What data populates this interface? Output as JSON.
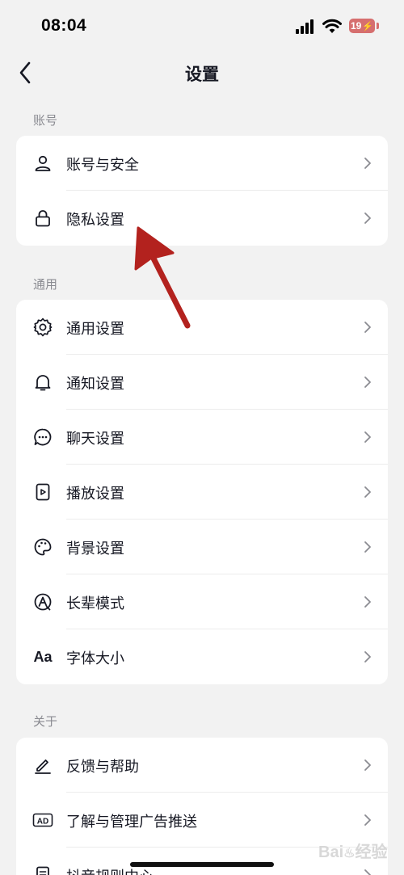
{
  "status_bar": {
    "time": "08:04",
    "battery": "19"
  },
  "nav": {
    "title": "设置"
  },
  "sections": {
    "account": {
      "title": "账号",
      "items": [
        {
          "label": "账号与安全",
          "icon": "user-icon"
        },
        {
          "label": "隐私设置",
          "icon": "lock-icon"
        }
      ]
    },
    "general": {
      "title": "通用",
      "items": [
        {
          "label": "通用设置",
          "icon": "gear-icon"
        },
        {
          "label": "通知设置",
          "icon": "bell-icon"
        },
        {
          "label": "聊天设置",
          "icon": "chat-bubble-icon"
        },
        {
          "label": "播放设置",
          "icon": "play-icon"
        },
        {
          "label": "背景设置",
          "icon": "palette-icon"
        },
        {
          "label": "长辈模式",
          "icon": "elder-mode-icon"
        },
        {
          "label": "字体大小",
          "icon": "font-size-icon",
          "icon_text": "Aa"
        }
      ]
    },
    "about": {
      "title": "关于",
      "items": [
        {
          "label": "反馈与帮助",
          "icon": "pen-icon"
        },
        {
          "label": "了解与管理广告推送",
          "icon": "ad-icon",
          "icon_text": "AD"
        },
        {
          "label": "抖音规则中心",
          "icon": "document-icon"
        }
      ]
    }
  },
  "annotation": {
    "arrow_color": "#b3221e"
  },
  "colors": {
    "background": "#f2f2f2",
    "card": "#ffffff",
    "text": "#161823",
    "section_title": "#8a8b91",
    "battery": "#d66f6f"
  }
}
